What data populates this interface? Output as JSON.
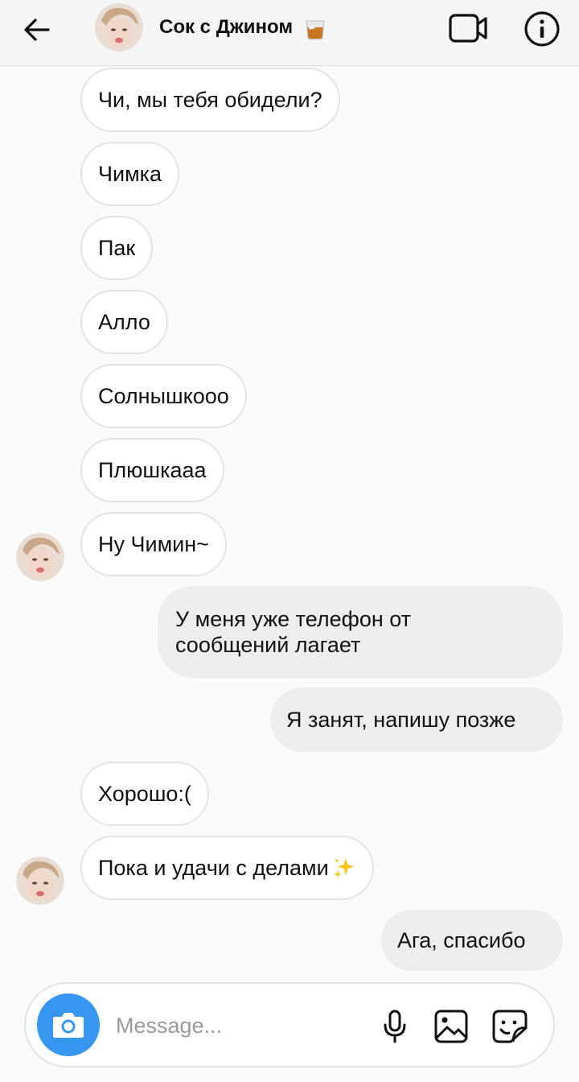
{
  "header": {
    "title": "Сок с Джином",
    "back_icon": "arrow-left-icon",
    "video_icon": "video-call-icon",
    "info_icon": "info-icon"
  },
  "messages": [
    {
      "text": "Чи, мы тебя обидели?",
      "side": "incoming"
    },
    {
      "text": "Чимка",
      "side": "incoming"
    },
    {
      "text": "Пак",
      "side": "incoming"
    },
    {
      "text": "Алло",
      "side": "incoming"
    },
    {
      "text": "Солнышкооо",
      "side": "incoming"
    },
    {
      "text": "Плюшкааа",
      "side": "incoming"
    },
    {
      "text": "Ну Чимин~",
      "side": "incoming"
    },
    {
      "text": "У меня уже телефон от сообщений лагает",
      "side": "outgoing"
    },
    {
      "text": "Я занят, напишу позже",
      "side": "outgoing"
    },
    {
      "text": "Хорошо:(",
      "side": "incoming"
    },
    {
      "text": "Пока и удачи с делами",
      "side": "incoming"
    },
    {
      "text": "Ага, спасибо",
      "side": "outgoing"
    }
  ],
  "composer": {
    "placeholder": "Message...",
    "camera_icon": "camera-icon",
    "mic_icon": "microphone-icon",
    "gallery_icon": "gallery-icon",
    "sticker_icon": "sticker-icon"
  },
  "colors": {
    "camera_button": "#3797f0",
    "outgoing_bubble": "#ededed",
    "incoming_border": "#e3e3e3",
    "background": "#fafafa"
  }
}
